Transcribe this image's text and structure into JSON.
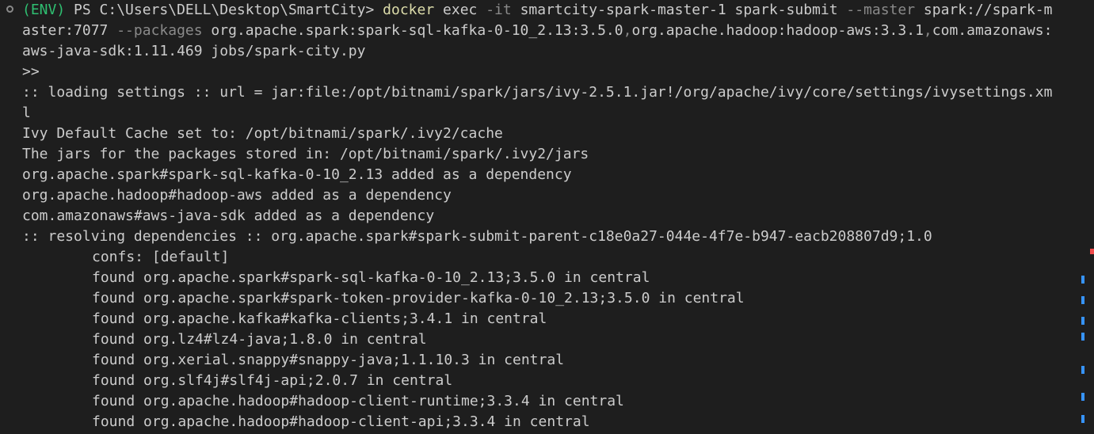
{
  "terminal": {
    "prompt": {
      "env": "(ENV)",
      "ps": " PS C:\\Users\\DELL\\Desktop\\SmartCity> ",
      "cmd": "docker",
      "seg1": " exec ",
      "flag_it": "-it",
      "seg2": " smartcity-spark-master-1 spark-submit ",
      "flag_master": "--master",
      "seg3": " spark://spark-m"
    },
    "wrap1": {
      "a": "aster:7077 ",
      "flag_packages": "--packages",
      "b": " org.apache.spark:spark-sql-kafka-0-10_2.13:3.5.0",
      "comma1": ",",
      "c": "org.apache.hadoop:hadoop-aws:3.3.1",
      "comma2": ",",
      "d": "com.amazonaws:"
    },
    "wrap2": "aws-java-sdk:1.11.469 jobs/spark-city.py",
    "lines": [
      ">>",
      ":: loading settings :: url = jar:file:/opt/bitnami/spark/jars/ivy-2.5.1.jar!/org/apache/ivy/core/settings/ivysettings.xm",
      "l",
      "Ivy Default Cache set to: /opt/bitnami/spark/.ivy2/cache",
      "The jars for the packages stored in: /opt/bitnami/spark/.ivy2/jars",
      "org.apache.spark#spark-sql-kafka-0-10_2.13 added as a dependency",
      "org.apache.hadoop#hadoop-aws added as a dependency",
      "com.amazonaws#aws-java-sdk added as a dependency",
      ":: resolving dependencies :: org.apache.spark#spark-submit-parent-c18e0a27-044e-4f7e-b947-eacb208807d9;1.0"
    ],
    "indented": [
      "confs: [default]",
      "found org.apache.spark#spark-sql-kafka-0-10_2.13;3.5.0 in central",
      "found org.apache.spark#spark-token-provider-kafka-0-10_2.13;3.5.0 in central",
      "found org.apache.kafka#kafka-clients;3.4.1 in central",
      "found org.lz4#lz4-java;1.8.0 in central",
      "found org.xerial.snappy#snappy-java;1.1.10.3 in central",
      "found org.slf4j#slf4j-api;2.0.7 in central",
      "found org.apache.hadoop#hadoop-client-runtime;3.3.4 in central",
      "found org.apache.hadoop#hadoop-client-api;3.3.4 in central"
    ]
  },
  "colors": {
    "background": "#1e1e1e",
    "text": "#cccccc",
    "env": "#2fbf71",
    "command": "#dcdcaa",
    "flag": "#8a8a8a",
    "scroll_error": "#f14c4c",
    "scroll_info": "#3794ff"
  },
  "icons": {
    "prompt_marker": "circle-outline-icon"
  }
}
